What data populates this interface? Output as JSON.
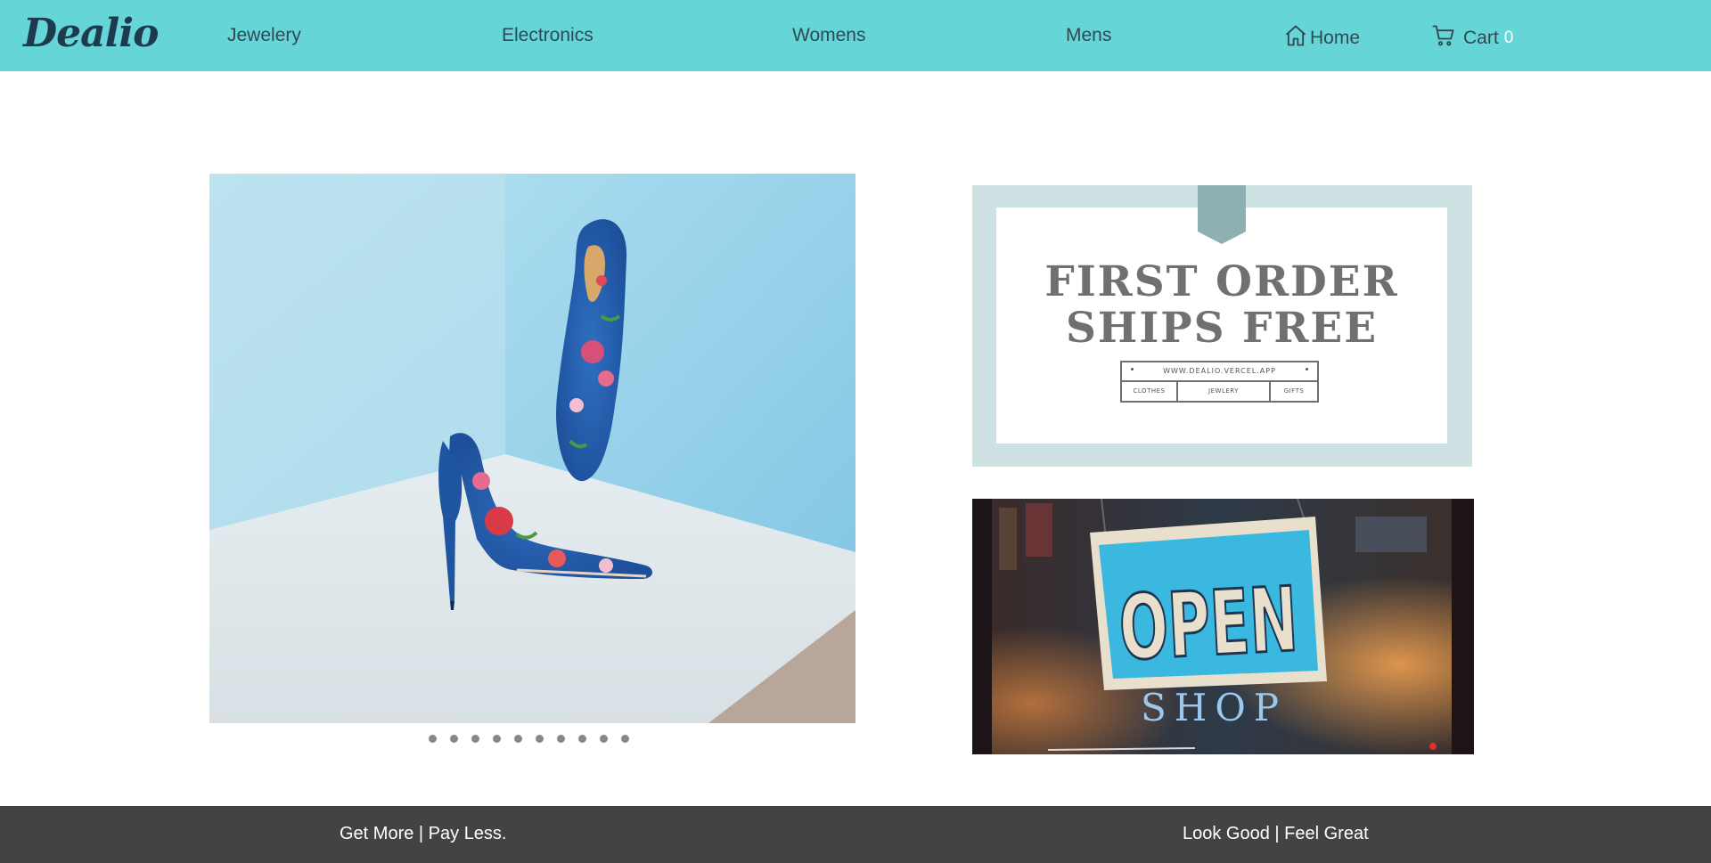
{
  "navbar": {
    "brand": "Dealio",
    "links": [
      "Jewelery",
      "Electronics",
      "Womens",
      "Mens"
    ],
    "home_label": "Home",
    "cart_label": "Cart",
    "cart_count": "0",
    "home_icon": "home-icon",
    "cart_icon": "cart-icon"
  },
  "carousel": {
    "slide_count": 10,
    "active_index": 0
  },
  "promo": {
    "headline_line1": "FIRST ORDER",
    "headline_line2": "SHIPS FREE",
    "url": "WWW.DEALIO.VERCEL.APP",
    "categories": [
      "CLOTHES",
      "JEWLERY",
      "GIFTS"
    ]
  },
  "open_sign": {
    "sign_text": "OPEN",
    "shop_text": "SHOP"
  },
  "footer": {
    "left_tagline": "Get More | Pay Less.",
    "right_tagline": "Look Good | Feel Great"
  },
  "colors": {
    "navbar": "#66d5d8",
    "footer": "#434343",
    "promo_frame": "#cfe2e3",
    "dot": "#888888"
  }
}
